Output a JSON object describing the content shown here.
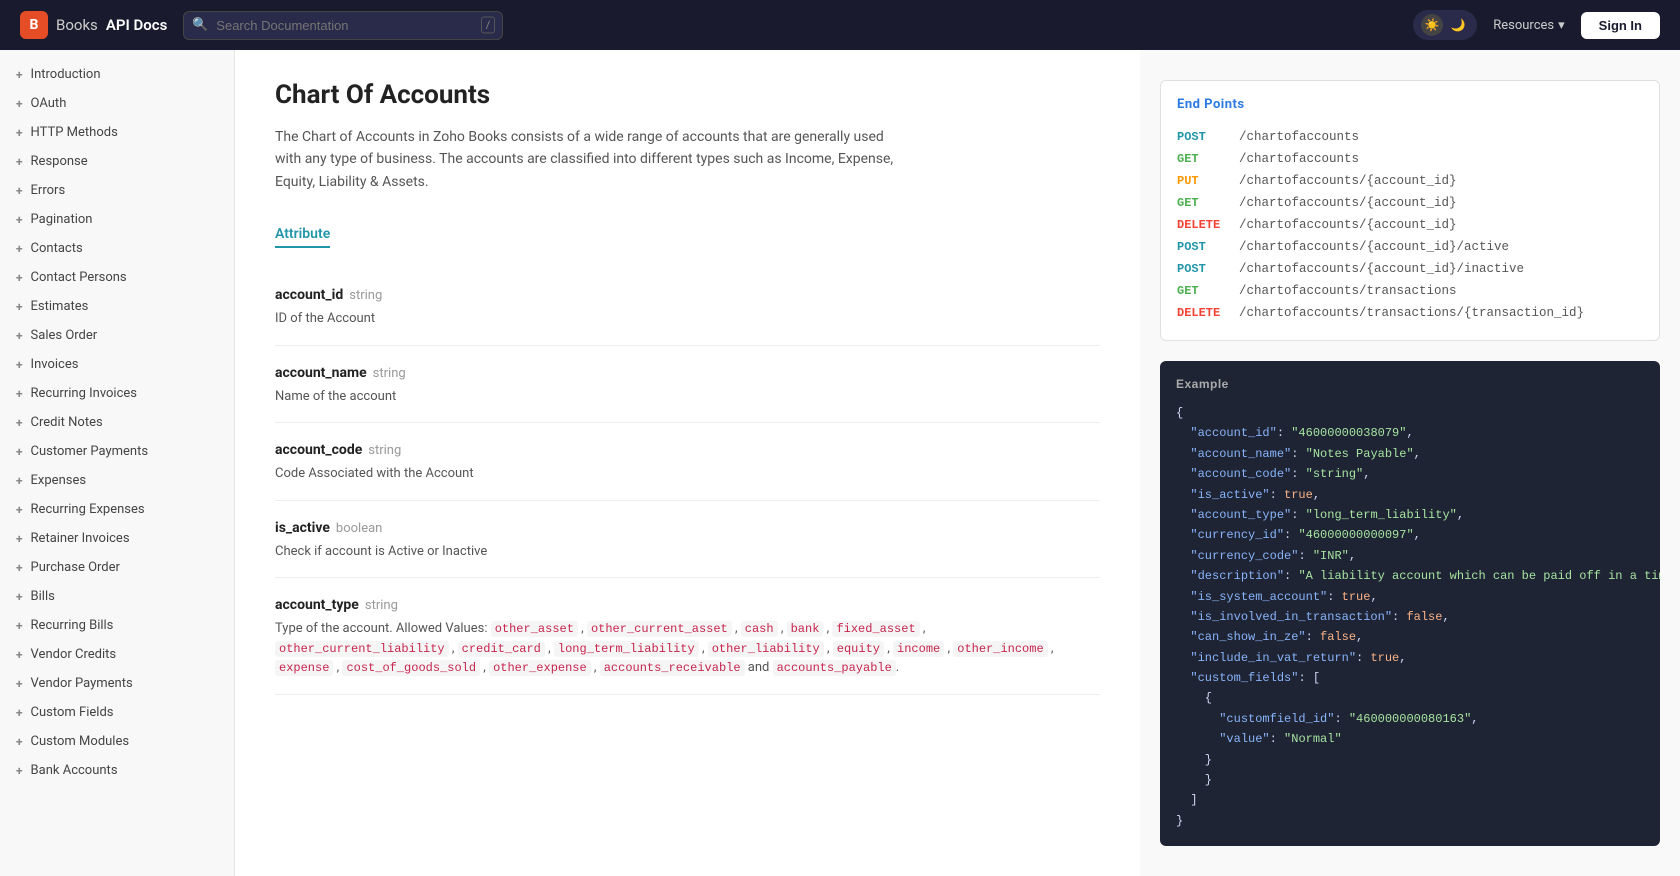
{
  "header": {
    "logo_app": "Books",
    "logo_api": "API Docs",
    "search_placeholder": "Search Documentation",
    "search_shortcut": "/",
    "resources_label": "Resources",
    "signin_label": "Sign In"
  },
  "sidebar": {
    "items": [
      {
        "id": "introduction",
        "label": "Introduction"
      },
      {
        "id": "oauth",
        "label": "OAuth"
      },
      {
        "id": "http-methods",
        "label": "HTTP Methods"
      },
      {
        "id": "response",
        "label": "Response"
      },
      {
        "id": "errors",
        "label": "Errors"
      },
      {
        "id": "pagination",
        "label": "Pagination"
      },
      {
        "id": "contacts",
        "label": "Contacts"
      },
      {
        "id": "contact-persons",
        "label": "Contact Persons"
      },
      {
        "id": "estimates",
        "label": "Estimates"
      },
      {
        "id": "sales-order",
        "label": "Sales Order"
      },
      {
        "id": "invoices",
        "label": "Invoices"
      },
      {
        "id": "recurring-invoices",
        "label": "Recurring Invoices"
      },
      {
        "id": "credit-notes",
        "label": "Credit Notes"
      },
      {
        "id": "customer-payments",
        "label": "Customer Payments"
      },
      {
        "id": "expenses",
        "label": "Expenses"
      },
      {
        "id": "recurring-expenses",
        "label": "Recurring Expenses"
      },
      {
        "id": "retainer-invoices",
        "label": "Retainer Invoices"
      },
      {
        "id": "purchase-order",
        "label": "Purchase Order"
      },
      {
        "id": "bills",
        "label": "Bills"
      },
      {
        "id": "recurring-bills",
        "label": "Recurring Bills"
      },
      {
        "id": "vendor-credits",
        "label": "Vendor Credits"
      },
      {
        "id": "vendor-payments",
        "label": "Vendor Payments"
      },
      {
        "id": "custom-fields",
        "label": "Custom Fields"
      },
      {
        "id": "custom-modules",
        "label": "Custom Modules"
      },
      {
        "id": "bank-accounts",
        "label": "Bank Accounts"
      }
    ]
  },
  "main": {
    "page_title": "Chart Of Accounts",
    "page_description": "The Chart of Accounts in Zoho Books consists of a wide range of accounts that are generally used with any type of business. The accounts are classified into different types such as Income, Expense, Equity, Liability & Assets.",
    "attribute_label": "Attribute",
    "attributes": [
      {
        "name": "account_id",
        "type": "string",
        "description": "ID of the Account"
      },
      {
        "name": "account_name",
        "type": "string",
        "description": "Name of the account"
      },
      {
        "name": "account_code",
        "type": "string",
        "description": "Code Associated with the Account"
      },
      {
        "name": "is_active",
        "type": "boolean",
        "description": "Check if account is Active or Inactive"
      },
      {
        "name": "account_type",
        "type": "string",
        "description": "Type of the account. Allowed Values: other_asset , other_current_asset , cash , bank , fixed_asset , other_current_liability , credit_card , long_term_liability , other_liability , equity , income , other_income , expense , cost_of_goods_sold , other_expense , accounts_receivable and accounts_payable ."
      }
    ]
  },
  "right_panel": {
    "endpoints_title": "End Points",
    "endpoints": [
      {
        "method": "POST",
        "path": "/chartofaccounts"
      },
      {
        "method": "GET",
        "path": "/chartofaccounts"
      },
      {
        "method": "PUT",
        "path": "/chartofaccounts/{account_id}"
      },
      {
        "method": "GET",
        "path": "/chartofaccounts/{account_id}"
      },
      {
        "method": "DELETE",
        "path": "/chartofaccounts/{account_id}"
      },
      {
        "method": "POST",
        "path": "/chartofaccounts/{account_id}/active"
      },
      {
        "method": "POST",
        "path": "/chartofaccounts/{account_id}/inactive"
      },
      {
        "method": "GET",
        "path": "/chartofaccounts/transactions"
      },
      {
        "method": "DELETE",
        "path": "/chartofaccounts/transactions/{transaction_id}"
      }
    ],
    "example_title": "Example",
    "example_json": [
      {
        "indent": 0,
        "content": "{",
        "type": "brace"
      },
      {
        "indent": 1,
        "key": "\"account_id\"",
        "value": "\"46000000038079\"",
        "comma": true,
        "type": "string"
      },
      {
        "indent": 1,
        "key": "\"account_name\"",
        "value": "\"Notes Payable\"",
        "comma": true,
        "type": "string"
      },
      {
        "indent": 1,
        "key": "\"account_code\"",
        "value": "\"string\"",
        "comma": true,
        "type": "string"
      },
      {
        "indent": 1,
        "key": "\"is_active\"",
        "value": "true",
        "comma": true,
        "type": "bool"
      },
      {
        "indent": 1,
        "key": "\"account_type\"",
        "value": "\"long_term_liability\"",
        "comma": true,
        "type": "string"
      },
      {
        "indent": 1,
        "key": "\"currency_id\"",
        "value": "\"46000000000097\"",
        "comma": true,
        "type": "string"
      },
      {
        "indent": 1,
        "key": "\"currency_code\"",
        "value": "\"INR\"",
        "comma": true,
        "type": "string"
      },
      {
        "indent": 1,
        "key": "\"description\"",
        "value": "\"A liability account which can be paid off in a time period\"",
        "comma": true,
        "type": "string"
      },
      {
        "indent": 1,
        "key": "\"is_system_account\"",
        "value": "true",
        "comma": true,
        "type": "bool"
      },
      {
        "indent": 1,
        "key": "\"is_involved_in_transaction\"",
        "value": "false",
        "comma": true,
        "type": "bool"
      },
      {
        "indent": 1,
        "key": "\"can_show_in_ze\"",
        "value": "false",
        "comma": true,
        "type": "bool"
      },
      {
        "indent": 1,
        "key": "\"include_in_vat_return\"",
        "value": "true",
        "comma": true,
        "type": "bool"
      },
      {
        "indent": 1,
        "key": "\"custom_fields\"",
        "value": "[",
        "comma": false,
        "type": "array-open"
      },
      {
        "indent": 2,
        "content": "{",
        "type": "brace"
      },
      {
        "indent": 3,
        "key": "\"customfield_id\"",
        "value": "\"460000000080163\"",
        "comma": true,
        "type": "string"
      },
      {
        "indent": 3,
        "key": "\"value\"",
        "value": "\"Normal\"",
        "comma": false,
        "type": "string"
      },
      {
        "indent": 2,
        "content": "}",
        "type": "brace"
      }
    ]
  }
}
